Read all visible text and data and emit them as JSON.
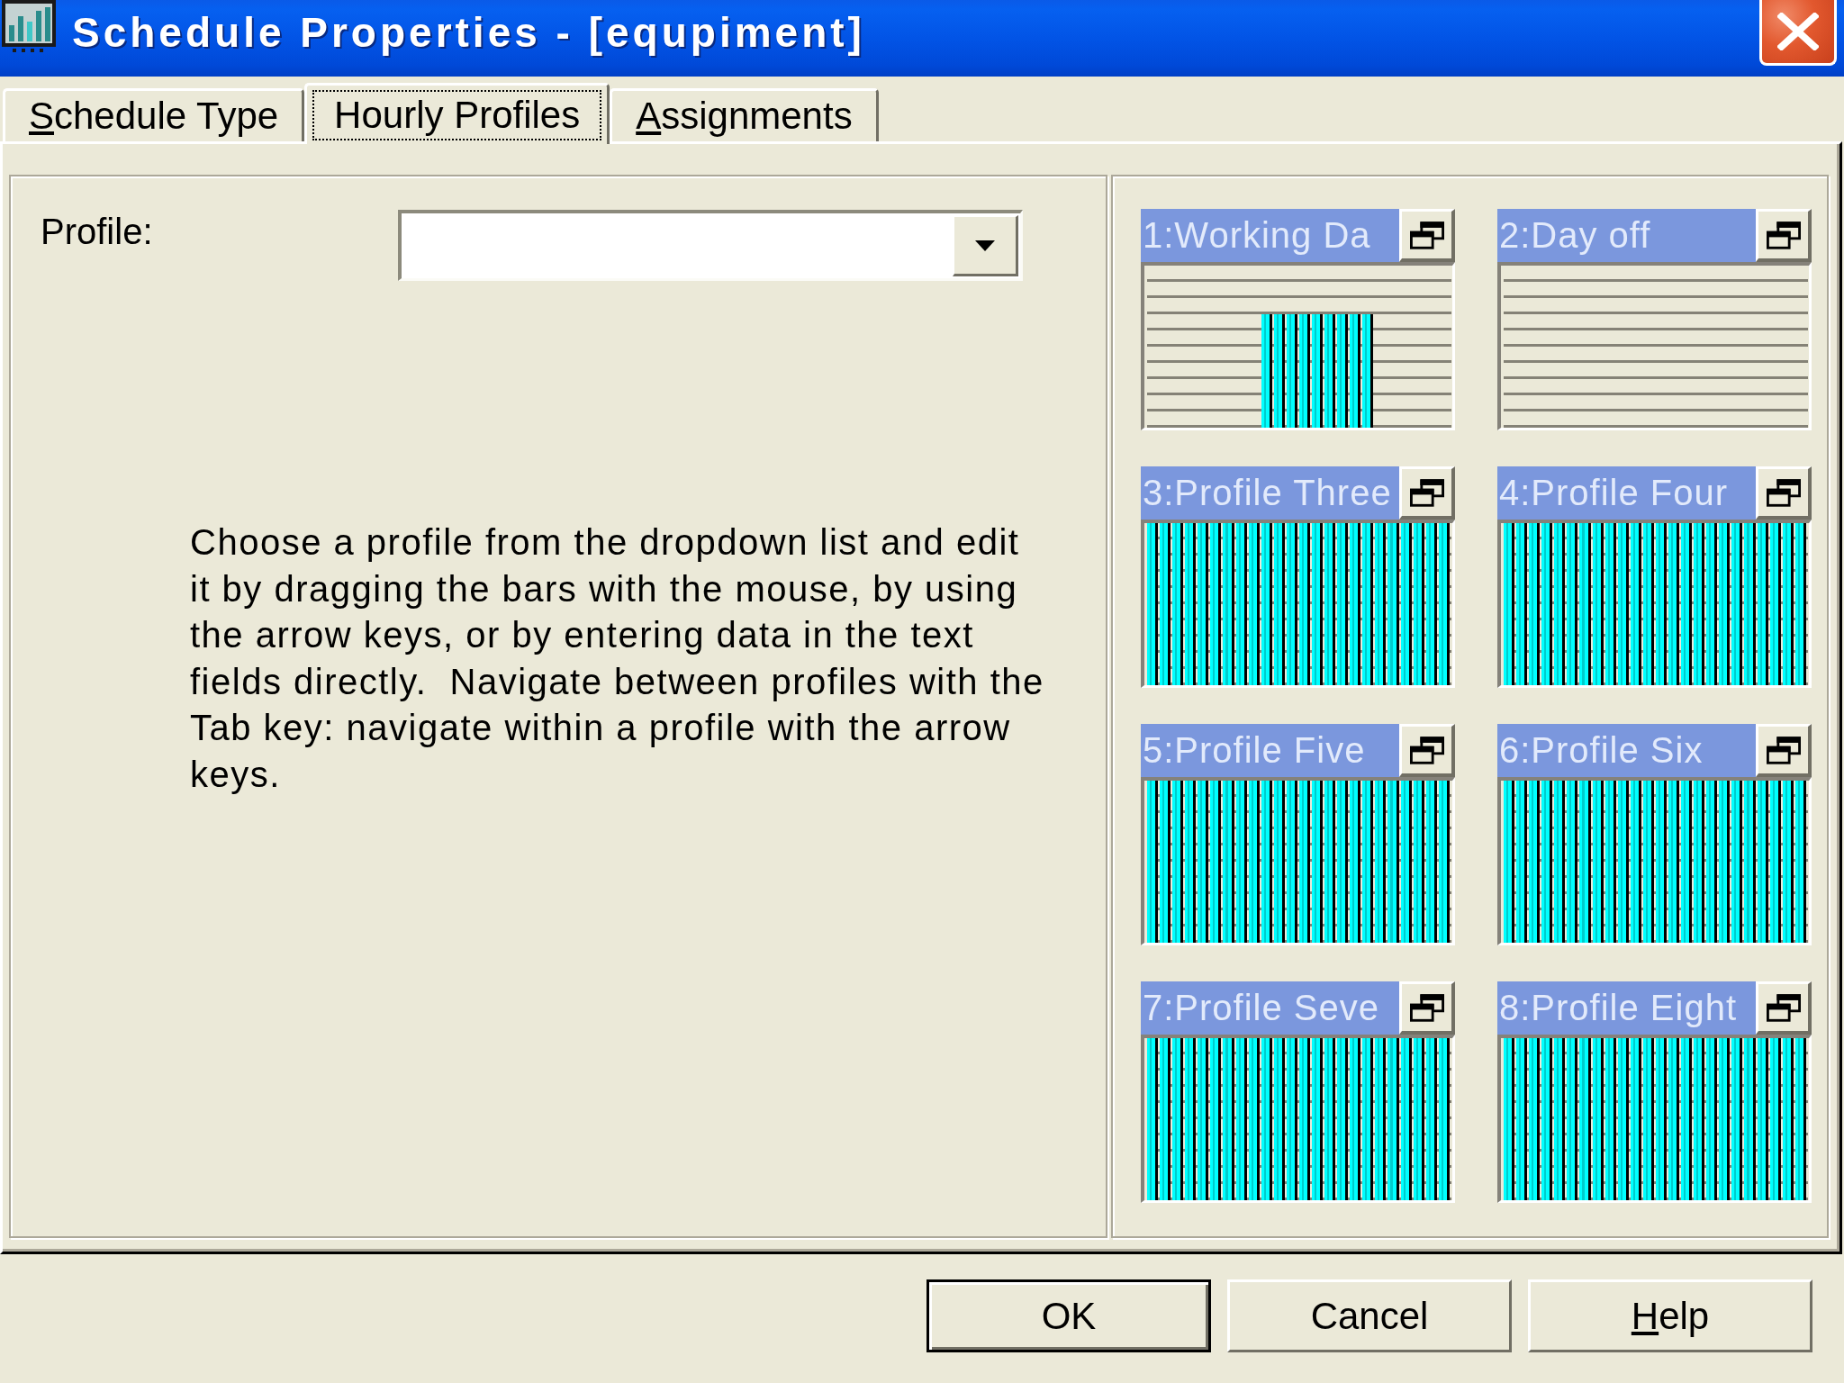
{
  "window": {
    "title": "Schedule Properties - [equpiment]"
  },
  "tabs": [
    {
      "label": "Schedule Type",
      "selected": false,
      "focused": false,
      "underlined_first_letter": true
    },
    {
      "label": "Hourly Profiles",
      "selected": true,
      "focused": true,
      "underlined_first_letter": false
    },
    {
      "label": "Assignments",
      "selected": false,
      "focused": false,
      "underlined_first_letter": true
    }
  ],
  "profile_picker": {
    "label": "Profile:"
  },
  "instructions": "Choose a profile from the dropdown list and edit it by dragging the bars with the mouse, by using the arrow keys, or by entering data in the text fields directly.  Navigate between profiles with the Tab key: navigate within a profile with the arrow keys.",
  "profiles": [
    {
      "title": "1:Working Da",
      "hours": [
        {
          "level": 0
        },
        {
          "level": 0
        },
        {
          "level": 0
        },
        {
          "level": 0
        },
        {
          "level": 0
        },
        {
          "level": 0
        },
        {
          "level": 0
        },
        {
          "level": 0
        },
        {
          "level": 0
        },
        {
          "level": 0.7
        },
        {
          "level": 0.7
        },
        {
          "level": 0.7
        },
        {
          "level": 0.7
        },
        {
          "level": 0.7
        },
        {
          "level": 0.7
        },
        {
          "level": 0.7
        },
        {
          "level": 0.7
        },
        {
          "level": 0.7
        },
        {
          "level": 0
        },
        {
          "level": 0
        },
        {
          "level": 0
        },
        {
          "level": 0
        },
        {
          "level": 0
        },
        {
          "level": 0
        }
      ]
    },
    {
      "title": "2:Day off",
      "hours": [
        {
          "level": 0
        },
        {
          "level": 0
        },
        {
          "level": 0
        },
        {
          "level": 0
        },
        {
          "level": 0
        },
        {
          "level": 0
        },
        {
          "level": 0
        },
        {
          "level": 0
        },
        {
          "level": 0
        },
        {
          "level": 0
        },
        {
          "level": 0
        },
        {
          "level": 0
        },
        {
          "level": 0
        },
        {
          "level": 0
        },
        {
          "level": 0
        },
        {
          "level": 0
        },
        {
          "level": 0
        },
        {
          "level": 0
        },
        {
          "level": 0
        },
        {
          "level": 0
        },
        {
          "level": 0
        },
        {
          "level": 0
        },
        {
          "level": 0
        },
        {
          "level": 0
        }
      ]
    },
    {
      "title": "3:Profile Three",
      "hours": [
        {
          "level": 1
        },
        {
          "level": 1
        },
        {
          "level": 1
        },
        {
          "level": 1
        },
        {
          "level": 1
        },
        {
          "level": 1
        },
        {
          "level": 1
        },
        {
          "level": 1
        },
        {
          "level": 1
        },
        {
          "level": 1
        },
        {
          "level": 1
        },
        {
          "level": 1
        },
        {
          "level": 1
        },
        {
          "level": 1
        },
        {
          "level": 1
        },
        {
          "level": 1
        },
        {
          "level": 1
        },
        {
          "level": 1
        },
        {
          "level": 1
        },
        {
          "level": 1
        },
        {
          "level": 1
        },
        {
          "level": 1
        },
        {
          "level": 1
        },
        {
          "level": 1
        }
      ]
    },
    {
      "title": "4:Profile Four",
      "hours": [
        {
          "level": 1
        },
        {
          "level": 1
        },
        {
          "level": 1
        },
        {
          "level": 1
        },
        {
          "level": 1
        },
        {
          "level": 1
        },
        {
          "level": 1
        },
        {
          "level": 1
        },
        {
          "level": 1
        },
        {
          "level": 1
        },
        {
          "level": 1
        },
        {
          "level": 1
        },
        {
          "level": 1
        },
        {
          "level": 1
        },
        {
          "level": 1
        },
        {
          "level": 1
        },
        {
          "level": 1
        },
        {
          "level": 1
        },
        {
          "level": 1
        },
        {
          "level": 1
        },
        {
          "level": 1
        },
        {
          "level": 1
        },
        {
          "level": 1
        },
        {
          "level": 1
        }
      ]
    },
    {
      "title": "5:Profile Five",
      "hours": [
        {
          "level": 1
        },
        {
          "level": 1
        },
        {
          "level": 1
        },
        {
          "level": 1
        },
        {
          "level": 1
        },
        {
          "level": 1
        },
        {
          "level": 1
        },
        {
          "level": 1
        },
        {
          "level": 1
        },
        {
          "level": 1
        },
        {
          "level": 1
        },
        {
          "level": 1
        },
        {
          "level": 1
        },
        {
          "level": 1
        },
        {
          "level": 1
        },
        {
          "level": 1
        },
        {
          "level": 1
        },
        {
          "level": 1
        },
        {
          "level": 1
        },
        {
          "level": 1
        },
        {
          "level": 1
        },
        {
          "level": 1
        },
        {
          "level": 1
        },
        {
          "level": 1
        }
      ]
    },
    {
      "title": "6:Profile Six",
      "hours": [
        {
          "level": 1
        },
        {
          "level": 1
        },
        {
          "level": 1
        },
        {
          "level": 1
        },
        {
          "level": 1
        },
        {
          "level": 1
        },
        {
          "level": 1
        },
        {
          "level": 1
        },
        {
          "level": 1
        },
        {
          "level": 1
        },
        {
          "level": 1
        },
        {
          "level": 1
        },
        {
          "level": 1
        },
        {
          "level": 1
        },
        {
          "level": 1
        },
        {
          "level": 1
        },
        {
          "level": 1
        },
        {
          "level": 1
        },
        {
          "level": 1
        },
        {
          "level": 1
        },
        {
          "level": 1
        },
        {
          "level": 1
        },
        {
          "level": 1
        },
        {
          "level": 1
        }
      ]
    },
    {
      "title": "7:Profile Seve",
      "hours": [
        {
          "level": 1
        },
        {
          "level": 1
        },
        {
          "level": 1
        },
        {
          "level": 1
        },
        {
          "level": 1
        },
        {
          "level": 1
        },
        {
          "level": 1
        },
        {
          "level": 1
        },
        {
          "level": 1
        },
        {
          "level": 1
        },
        {
          "level": 1
        },
        {
          "level": 1
        },
        {
          "level": 1
        },
        {
          "level": 1
        },
        {
          "level": 1
        },
        {
          "level": 1
        },
        {
          "level": 1
        },
        {
          "level": 1
        },
        {
          "level": 1
        },
        {
          "level": 1
        },
        {
          "level": 1
        },
        {
          "level": 1
        },
        {
          "level": 1
        },
        {
          "level": 1
        }
      ]
    },
    {
      "title": "8:Profile Eight",
      "hours": [
        {
          "level": 1
        },
        {
          "level": 1
        },
        {
          "level": 1
        },
        {
          "level": 1
        },
        {
          "level": 1
        },
        {
          "level": 1
        },
        {
          "level": 1
        },
        {
          "level": 1
        },
        {
          "level": 1
        },
        {
          "level": 1
        },
        {
          "level": 1
        },
        {
          "level": 1
        },
        {
          "level": 1
        },
        {
          "level": 1
        },
        {
          "level": 1
        },
        {
          "level": 1
        },
        {
          "level": 1
        },
        {
          "level": 1
        },
        {
          "level": 1
        },
        {
          "level": 1
        },
        {
          "level": 1
        },
        {
          "level": 1
        },
        {
          "level": 1
        },
        {
          "level": 1
        }
      ]
    }
  ],
  "buttons": [
    {
      "label": "OK",
      "default": true,
      "underlined_first_letter": false
    },
    {
      "label": "Cancel",
      "default": false,
      "underlined_first_letter": false
    },
    {
      "label": "Help",
      "default": false,
      "underlined_first_letter": true
    }
  ]
}
